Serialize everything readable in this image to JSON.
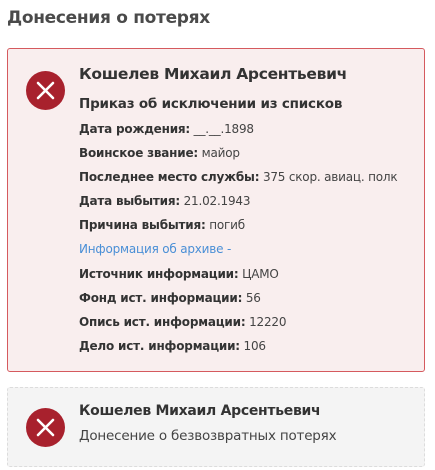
{
  "section": {
    "title": "Донесения о потерях"
  },
  "colors": {
    "icon_background": "#a8212d",
    "active_card_border": "#d55a5e",
    "active_card_background": "#f9eeee",
    "link": "#4a8fd6"
  },
  "cards": [
    {
      "icon": "close-x-icon",
      "name": "Кошелев Михаил Арсентьевич",
      "subtitle": "Приказ об исключении из списков",
      "fields": [
        {
          "label": "Дата рождения:",
          "value": "__.__.1898"
        },
        {
          "label": "Воинское звание:",
          "value": "майор"
        },
        {
          "label": "Последнее место службы:",
          "value": "375 скор. авиац. полк"
        },
        {
          "label": "Дата выбытия:",
          "value": "21.02.1943"
        },
        {
          "label": "Причина выбытия:",
          "value": "погиб"
        }
      ],
      "archive_link": "Информация об архиве -",
      "source_fields": [
        {
          "label": "Источник информации:",
          "value": "ЦАМО"
        },
        {
          "label": "Фонд ист. информации:",
          "value": "56"
        },
        {
          "label": "Опись ист. информации:",
          "value": "12220"
        },
        {
          "label": "Дело ист. информации:",
          "value": "106"
        }
      ]
    },
    {
      "icon": "close-x-icon",
      "name": "Кошелев Михаил Арсентьевич",
      "subtitle": "Донесение о безвозвратных потерях"
    }
  ]
}
